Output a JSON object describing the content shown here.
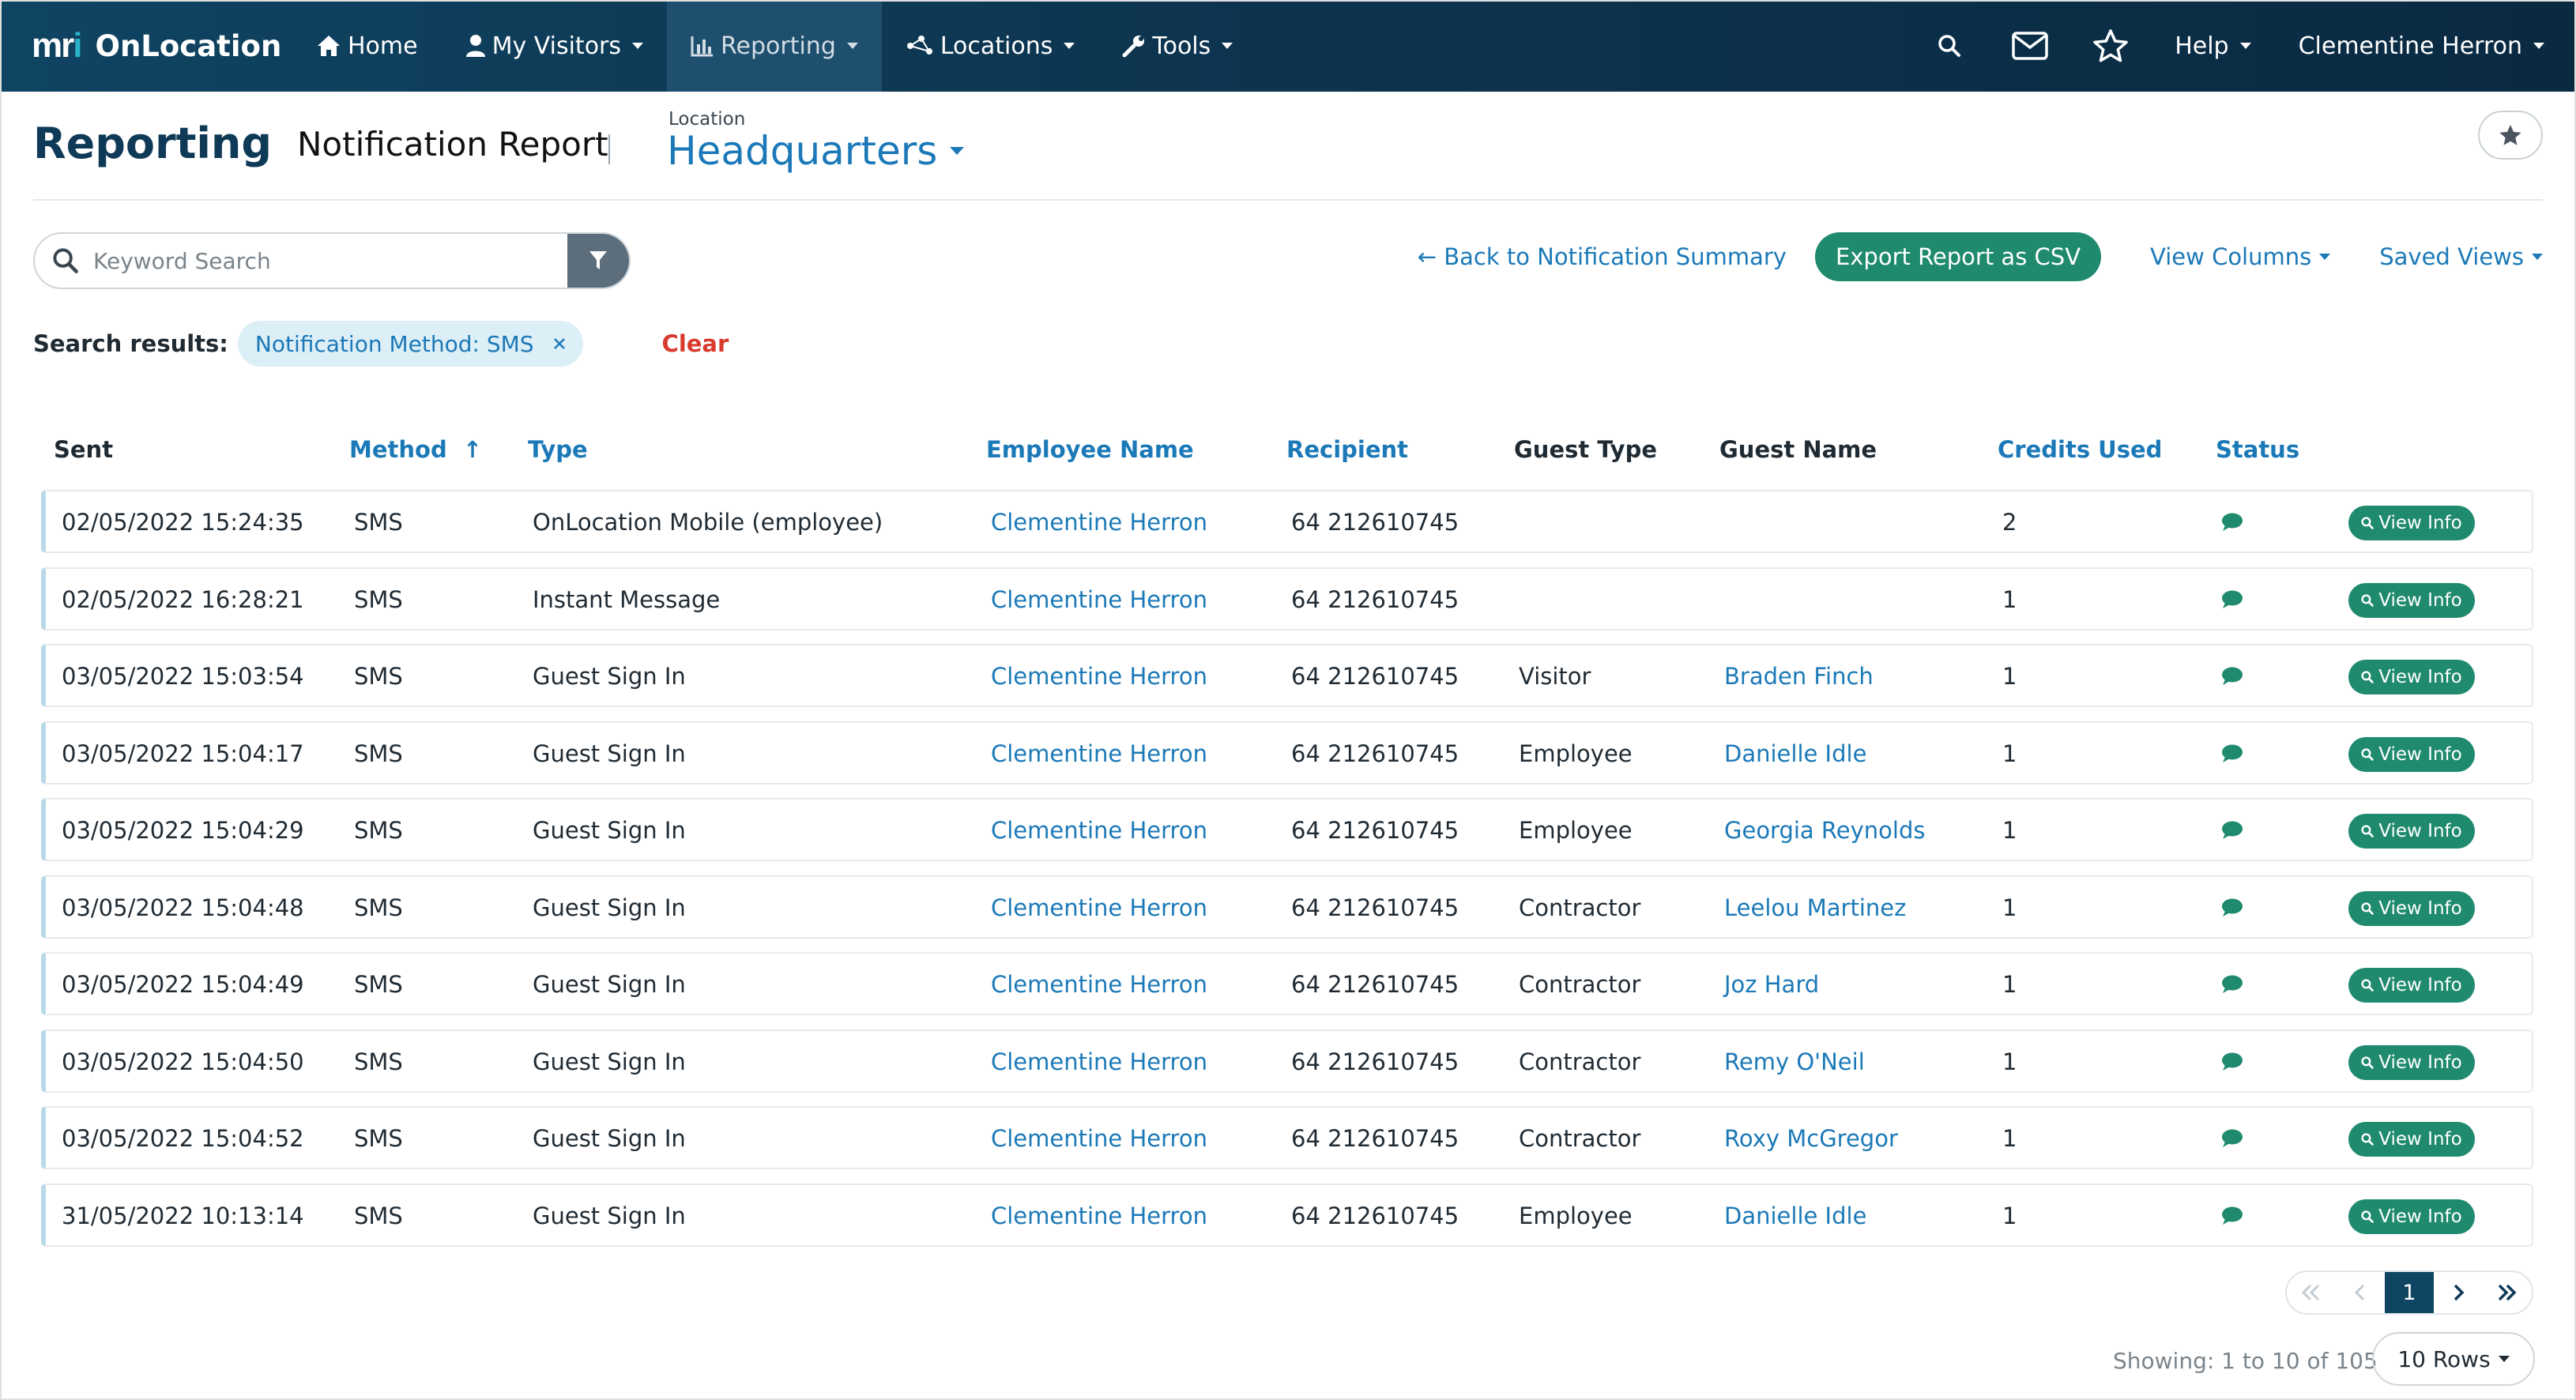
{
  "app": {
    "brand_mark": "mri",
    "brand_name": "OnLocation"
  },
  "nav": {
    "items": [
      {
        "label": "Home",
        "icon": "home-icon"
      },
      {
        "label": "My Visitors",
        "icon": "user-icon"
      },
      {
        "label": "Reporting",
        "icon": "chart-icon",
        "active": true
      },
      {
        "label": "Locations",
        "icon": "network-icon"
      },
      {
        "label": "Tools",
        "icon": "wrench-icon"
      }
    ],
    "help": "Help",
    "user": "Clementine Herron"
  },
  "header": {
    "title": "Reporting",
    "subtitle": "Notification Report",
    "location_label": "Location",
    "location_value": "Headquarters"
  },
  "toolbar": {
    "search_placeholder": "Keyword Search",
    "back_link": "← Back to Notification Summary",
    "export_label": "Export Report as CSV",
    "view_columns": "View Columns",
    "saved_views": "Saved Views"
  },
  "results": {
    "label": "Search results:",
    "filter_chip": "Notification Method: SMS",
    "clear": "Clear"
  },
  "table": {
    "columns": [
      "Sent",
      "Method",
      "Type",
      "Employee Name",
      "Recipient",
      "Guest Type",
      "Guest Name",
      "Credits Used",
      "Status"
    ],
    "sort_indicator": "↑",
    "view_info_label": "View Info",
    "rows": [
      {
        "sent": "02/05/2022 15:24:35",
        "method": "SMS",
        "type": "OnLocation Mobile (employee)",
        "employee": "Clementine Herron",
        "recipient": "64 212610745",
        "guest_type": "",
        "guest_name": "",
        "credits": "2"
      },
      {
        "sent": "02/05/2022 16:28:21",
        "method": "SMS",
        "type": "Instant Message",
        "employee": "Clementine Herron",
        "recipient": "64 212610745",
        "guest_type": "",
        "guest_name": "",
        "credits": "1"
      },
      {
        "sent": "03/05/2022 15:03:54",
        "method": "SMS",
        "type": "Guest Sign In",
        "employee": "Clementine Herron",
        "recipient": "64 212610745",
        "guest_type": "Visitor",
        "guest_name": "Braden Finch",
        "credits": "1"
      },
      {
        "sent": "03/05/2022 15:04:17",
        "method": "SMS",
        "type": "Guest Sign In",
        "employee": "Clementine Herron",
        "recipient": "64 212610745",
        "guest_type": "Employee",
        "guest_name": "Danielle Idle",
        "credits": "1"
      },
      {
        "sent": "03/05/2022 15:04:29",
        "method": "SMS",
        "type": "Guest Sign In",
        "employee": "Clementine Herron",
        "recipient": "64 212610745",
        "guest_type": "Employee",
        "guest_name": "Georgia Reynolds",
        "credits": "1"
      },
      {
        "sent": "03/05/2022 15:04:48",
        "method": "SMS",
        "type": "Guest Sign In",
        "employee": "Clementine Herron",
        "recipient": "64 212610745",
        "guest_type": "Contractor",
        "guest_name": "Leelou Martinez",
        "credits": "1"
      },
      {
        "sent": "03/05/2022 15:04:49",
        "method": "SMS",
        "type": "Guest Sign In",
        "employee": "Clementine Herron",
        "recipient": "64 212610745",
        "guest_type": "Contractor",
        "guest_name": "Joz Hard",
        "credits": "1"
      },
      {
        "sent": "03/05/2022 15:04:50",
        "method": "SMS",
        "type": "Guest Sign In",
        "employee": "Clementine Herron",
        "recipient": "64 212610745",
        "guest_type": "Contractor",
        "guest_name": "Remy O'Neil",
        "credits": "1"
      },
      {
        "sent": "03/05/2022 15:04:52",
        "method": "SMS",
        "type": "Guest Sign In",
        "employee": "Clementine Herron",
        "recipient": "64 212610745",
        "guest_type": "Contractor",
        "guest_name": "Roxy McGregor",
        "credits": "1"
      },
      {
        "sent": "31/05/2022 10:13:14",
        "method": "SMS",
        "type": "Guest Sign In",
        "employee": "Clementine Herron",
        "recipient": "64 212610745",
        "guest_type": "Employee",
        "guest_name": "Danielle Idle",
        "credits": "1"
      }
    ]
  },
  "pagination": {
    "current_page": "1",
    "showing": "Showing: 1 to 10 of 105",
    "rows_per_page": "10 Rows"
  },
  "colors": {
    "nav_bg": "#0d3550",
    "accent_green": "#1f8a6e",
    "link_blue": "#1b79b8",
    "clear_red": "#d83a2c"
  }
}
